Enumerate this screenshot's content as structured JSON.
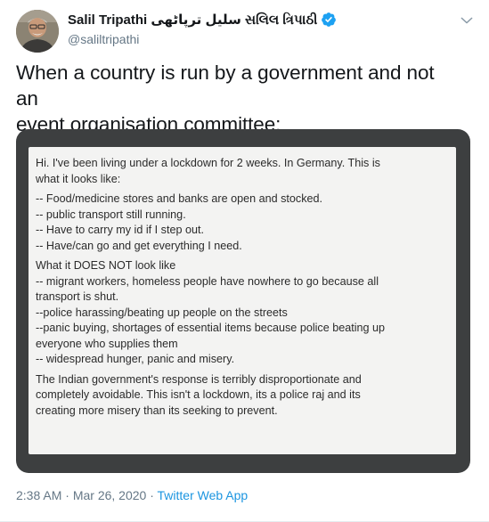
{
  "author": {
    "name": "Salil Tripathi سلیل ترپاٹھی સલિલ ત્રિપાઠી",
    "handle": "@saliltripathi",
    "verified": true
  },
  "tweet": {
    "text_line1": "When a country is run by a government and not an",
    "text_line2": "event organisation committee:"
  },
  "screenshot_post": {
    "para1": [
      "Hi. I've been living under a lockdown for 2 weeks. In Germany. This is",
      "what it looks like:"
    ],
    "para2": [
      "-- Food/medicine stores and banks are open and stocked.",
      "-- public transport still running.",
      "-- Have to carry my id if I step out.",
      "-- Have/can go and get everything I need."
    ],
    "para3": [
      "What it DOES NOT look like",
      "-- migrant workers, homeless people have nowhere to go because all",
      "transport is shut.",
      "--police harassing/beating up people on the streets",
      "--panic buying, shortages of essential items because police beating up",
      "everyone who supplies them",
      "-- widespread hunger, panic and misery."
    ],
    "para4": [
      "The Indian government's response is terribly disproportionate and",
      "completely avoidable. This isn't a lockdown, its a police raj and its",
      "creating more misery than its seeking to prevent."
    ]
  },
  "meta": {
    "time": "2:38 AM",
    "separator1": " · ",
    "date": "Mar 26, 2020",
    "separator2": " · ",
    "source": "Twitter Web App"
  },
  "colors": {
    "accent": "#1da1f2",
    "source_link": "#1b95e0",
    "secondary_text": "#657786",
    "media_bg": "#3d3f40",
    "media_inner": "#f3f3f2"
  },
  "icons": {
    "verified": "verified-badge-icon",
    "menu": "chevron-down-icon"
  }
}
